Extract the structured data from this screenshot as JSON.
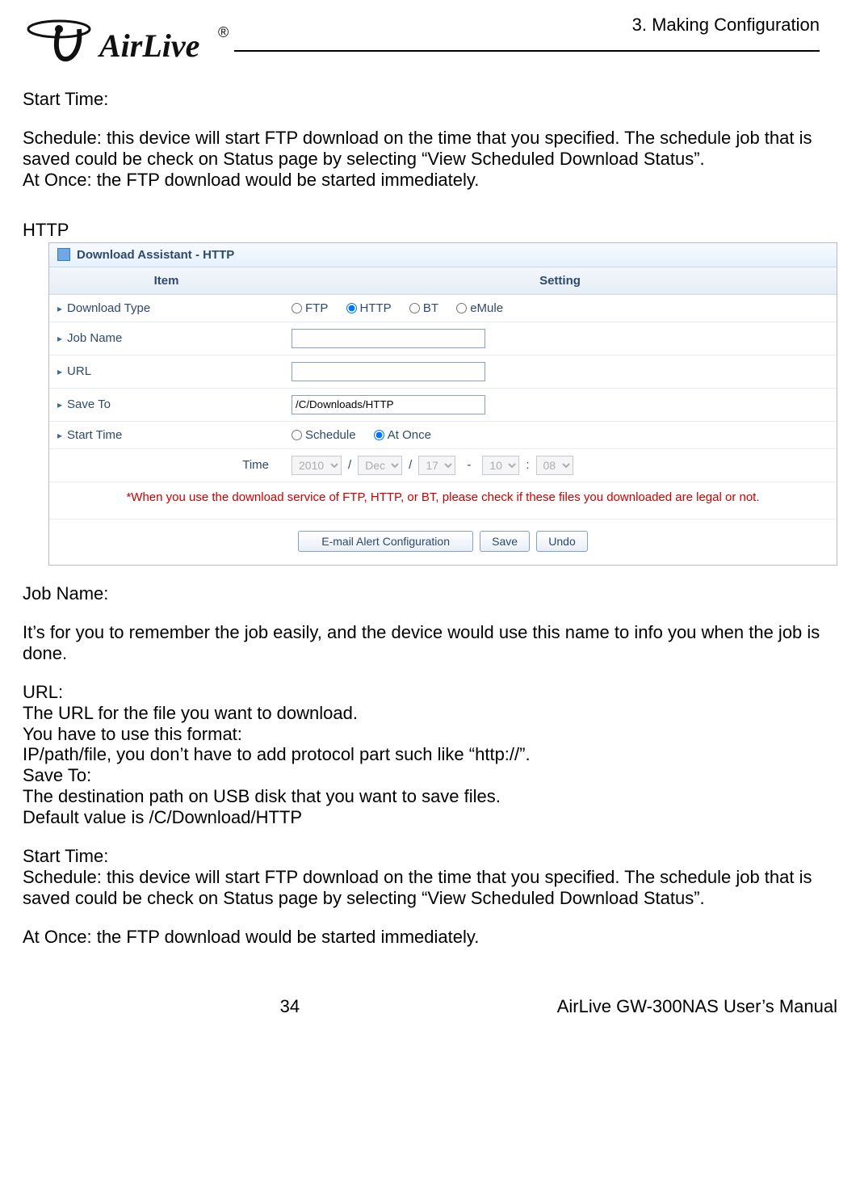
{
  "header": {
    "chapter": "3. Making Configuration"
  },
  "logo_text": "AirLive",
  "sections": {
    "start_time_upper": {
      "title": "Start Time:",
      "p1": "Schedule: this device will start FTP download on the time that you specified. The schedule job that is saved could be check on Status page by selecting “View Scheduled Download Status”.",
      "p2": "At Once: the FTP download would be started immediately."
    },
    "http_heading": "HTTP",
    "job_name": {
      "title": "Job Name:",
      "p1": "It’s for you to remember the job easily, and the device would use this name to info you when the job is done."
    },
    "url": {
      "title": "URL:",
      "l1": "The URL for the file you want to download.",
      "l2": "You have to use this format:",
      "l3": "IP/path/file, you don’t have to add protocol part such like “http://”."
    },
    "save_to": {
      "title": "Save To:",
      "l1": "The destination path on USB disk that you want to save files.",
      "l2": "Default value is /C/Download/HTTP"
    },
    "start_time_lower": {
      "title": "Start Time:",
      "p1": "Schedule: this device will start FTP download on the time that you specified. The schedule job that is saved could be check on Status page by selecting “View Scheduled Download Status”.",
      "p2": "At Once: the FTP download would be started immediately."
    }
  },
  "ui": {
    "title": "Download Assistant - HTTP",
    "columns": {
      "item": "Item",
      "setting": "Setting"
    },
    "rows": {
      "download_type": {
        "label": "Download Type",
        "options": {
          "ftp": "FTP",
          "http": "HTTP",
          "bt": "BT",
          "emule": "eMule"
        },
        "selected": "http"
      },
      "job_name": {
        "label": "Job Name",
        "value": ""
      },
      "url": {
        "label": "URL",
        "value": ""
      },
      "save_to": {
        "label": "Save To",
        "value": "/C/Downloads/HTTP"
      },
      "start_time": {
        "label": "Start Time",
        "options": {
          "schedule": "Schedule",
          "at_once": "At Once"
        },
        "selected": "at_once"
      },
      "time": {
        "label": "Time",
        "year": "2010",
        "month": "Dec",
        "day": "17",
        "hour": "10",
        "minute": "08"
      }
    },
    "warning": "*When you use the download service of FTP, HTTP, or BT, please check if these files you downloaded are legal or not.",
    "buttons": {
      "email": "E-mail Alert Configuration",
      "save": "Save",
      "undo": "Undo"
    }
  },
  "footer": {
    "page": "34",
    "manual": "AirLive GW-300NAS User’s Manual"
  }
}
